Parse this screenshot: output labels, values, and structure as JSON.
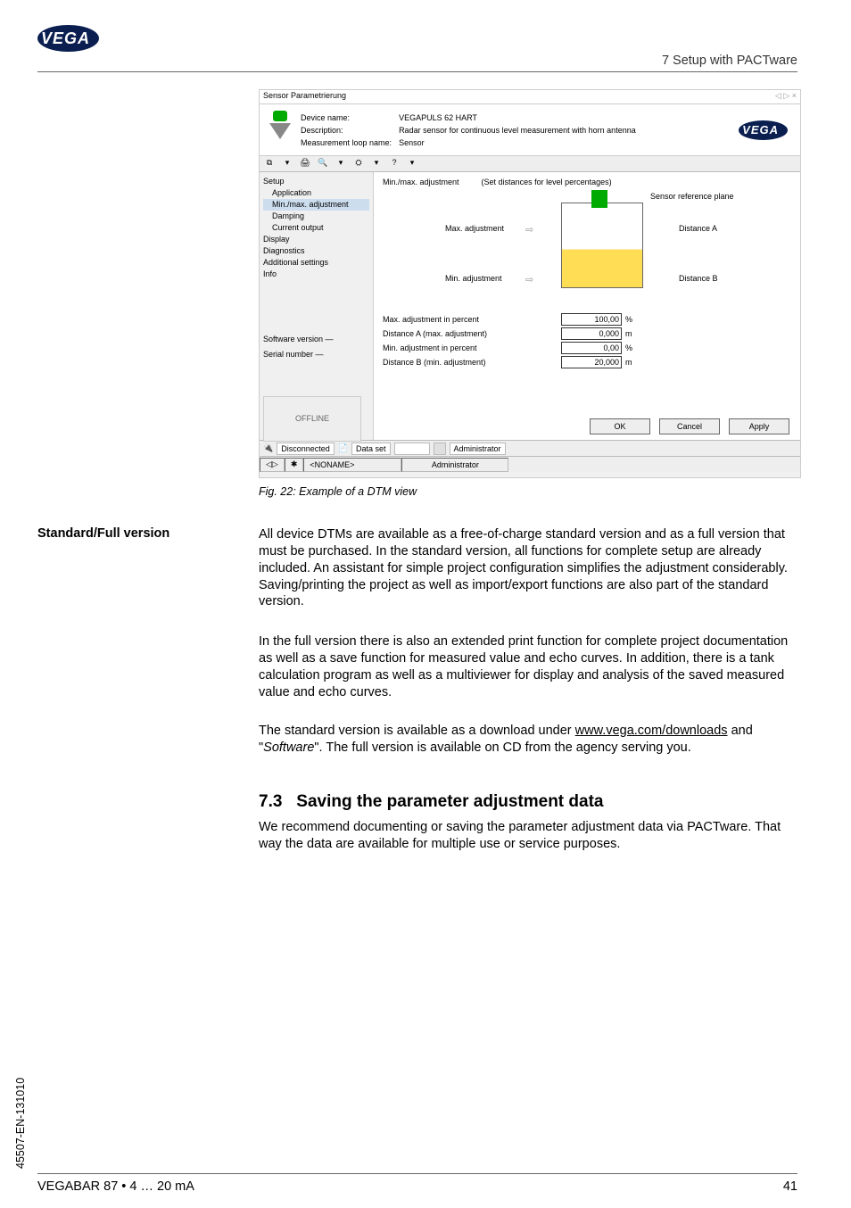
{
  "header": {
    "section": "7 Setup with PACTware"
  },
  "logo_text": "VEGA",
  "screenshot": {
    "title": "Sensor Parametrierung",
    "close_icons": "◁ ▷ ×",
    "header_labels": {
      "l1": "Device name:",
      "l2": "Description:",
      "l3": "Measurement loop name:"
    },
    "header_values": {
      "v1": "VEGAPULS 62 HART",
      "v2": "Radar sensor for continuous level measurement with horn antenna",
      "v3": "Sensor"
    },
    "toolbar": [
      "⧉",
      "▾",
      "🖨",
      "🔍",
      "▾",
      "⛭",
      "▾",
      "?",
      "▾"
    ],
    "tree": {
      "n0": "Setup",
      "n1": "Application",
      "n2": "Min./max. adjustment",
      "n3": "Damping",
      "n4": "Current output",
      "n5": "Display",
      "n6": "Diagnostics",
      "n7": "Additional settings",
      "n8": "Info",
      "sw": "Software version   —",
      "sn": "Serial number        —",
      "offline": "OFFLINE"
    },
    "main": {
      "title": "Min./max. adjustment",
      "hint": "(Set distances for level percentages)",
      "ref": "Sensor reference plane",
      "maxlbl": "Max. adjustment",
      "minlbl": "Min. adjustment",
      "dista": "Distance A",
      "distb": "Distance B",
      "arrow": "⇨",
      "fields": {
        "flabel1": "Max. adjustment in percent",
        "fval1": "100,00",
        "funit1": "%",
        "flabel2": "Distance A (max. adjustment)",
        "fval2": "0,000",
        "funit2": "m",
        "flabel3": "Min. adjustment in percent",
        "fval3": "0,00",
        "funit3": "%",
        "flabel4": "Distance B (min. adjustment)",
        "fval4": "20,000",
        "funit4": "m"
      },
      "buttons": {
        "ok": "OK",
        "cancel": "Cancel",
        "apply": "Apply"
      }
    },
    "status": {
      "s1": "Disconnected",
      "s2": "Data set",
      "s3": "Administrator"
    },
    "status2": {
      "a": "◁▷",
      "b": "✱",
      "c": "<NONAME>",
      "d": "Administrator"
    }
  },
  "caption": "Fig. 22: Example of a DTM view",
  "side_heading": "Standard/Full version",
  "para1": "All device DTMs are available as a free-of-charge standard version and as a full version that must be purchased. In the standard version, all functions for complete setup are already included. An assistant for simple project configuration simplifies the adjustment considerably. Saving/printing the project as well as import/export functions are also part of the standard version.",
  "para2": "In the full version there is also an extended print function for complete project documentation as well as a save function for measured value and echo curves. In addition, there is a tank calculation program as well as a multiviewer for display and analysis of the saved measured value and echo curves.",
  "para3a": "The standard version is available as a download under ",
  "para3_link": "www.vega.com/downloads",
  "para3b": " and \"",
  "para3_sw": "Software",
  "para3c": "\". The full version is available on CD from the agency serving you.",
  "h73_num": "7.3",
  "h73_title": "Saving the parameter adjustment data",
  "para4": "We recommend documenting or saving the parameter adjustment data via PACTware. That way the data are available for multiple use or service purposes.",
  "doc_id": "45507-EN-131010",
  "footer_left": "VEGABAR 87 • 4 … 20 mA",
  "footer_right": "41"
}
